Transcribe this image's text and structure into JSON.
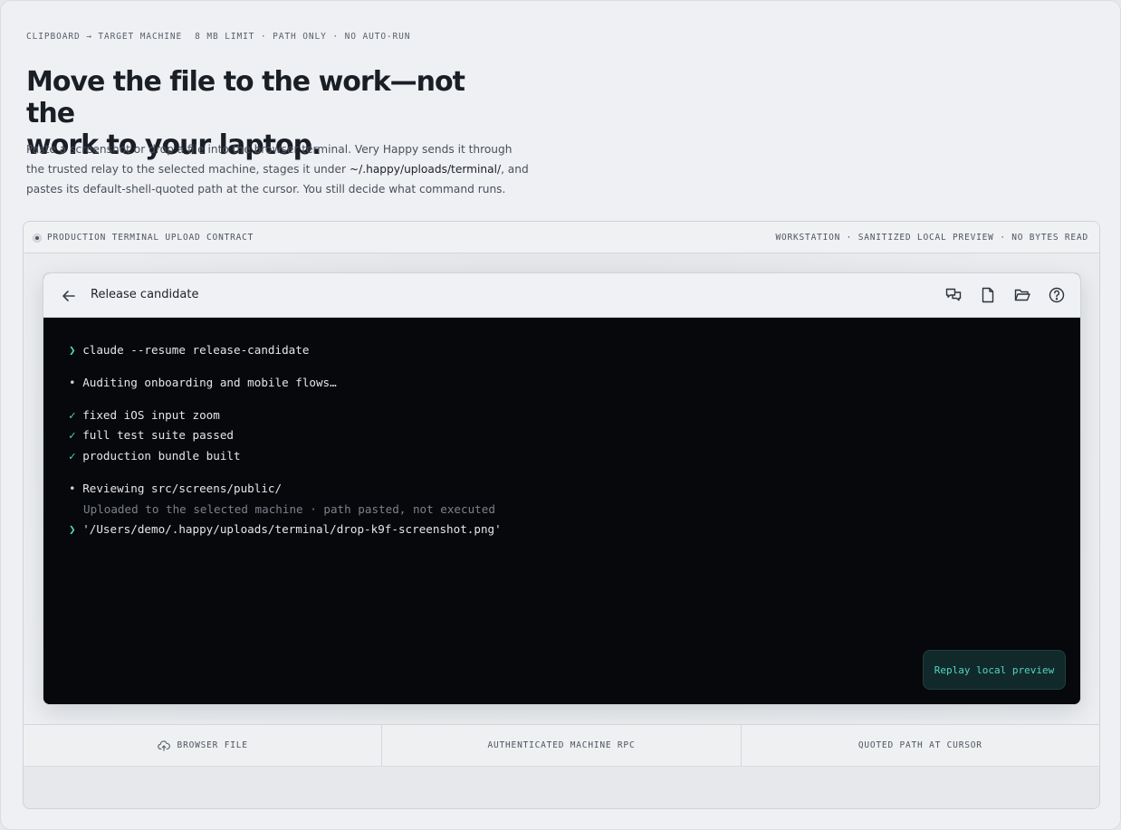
{
  "eyebrow": {
    "part1": "CLIPBOARD → TARGET MACHINE",
    "part2": "8 MB LIMIT · PATH ONLY · NO AUTO-RUN"
  },
  "hero": {
    "headline_line1": "Move the file to the work—not the",
    "headline_line2": "work to your laptop.",
    "lede_part1": "Paste a screenshot or drop a file into the browser terminal. Very Happy sends it through the trusted relay to the selected machine, stages it under ",
    "lede_path": "~/.happy/uploads/terminal/",
    "lede_part2": ", and pastes its default-shell-quoted path at the cursor. You still decide what command runs."
  },
  "panel": {
    "label": "PRODUCTION TERMINAL UPLOAD CONTRACT",
    "status": "WORKSTATION · SANITIZED LOCAL PREVIEW · NO BYTES READ"
  },
  "window": {
    "title": "Release candidate",
    "icons": [
      "chat-icon",
      "file-icon",
      "folder-open-icon",
      "help-icon"
    ]
  },
  "terminal": {
    "cmd_prompt": "❯",
    "cmd": "claude --resume release-candidate",
    "bullet": "•",
    "check": "✓",
    "line_auditing": "Auditing onboarding and mobile flows…",
    "checks": [
      "fixed iOS input zoom",
      "full test suite passed",
      "production bundle built"
    ],
    "line_reviewing": "Reviewing src/screens/public/",
    "line_uploaded": "Uploaded to the selected machine · path pasted, not executed",
    "pasted_path": "'/Users/demo/.happy/uploads/terminal/drop-k9f-screenshot.png'"
  },
  "replay_button": "Replay local preview",
  "footer": {
    "browser_file": "BROWSER FILE",
    "machine_rpc": "AUTHENTICATED MACHINE RPC",
    "quoted_path": "QUOTED PATH AT CURSOR"
  },
  "colors": {
    "accent": "#4fd6c1",
    "terminal_bg": "#07080b",
    "page_bg": "#eef0f3"
  }
}
